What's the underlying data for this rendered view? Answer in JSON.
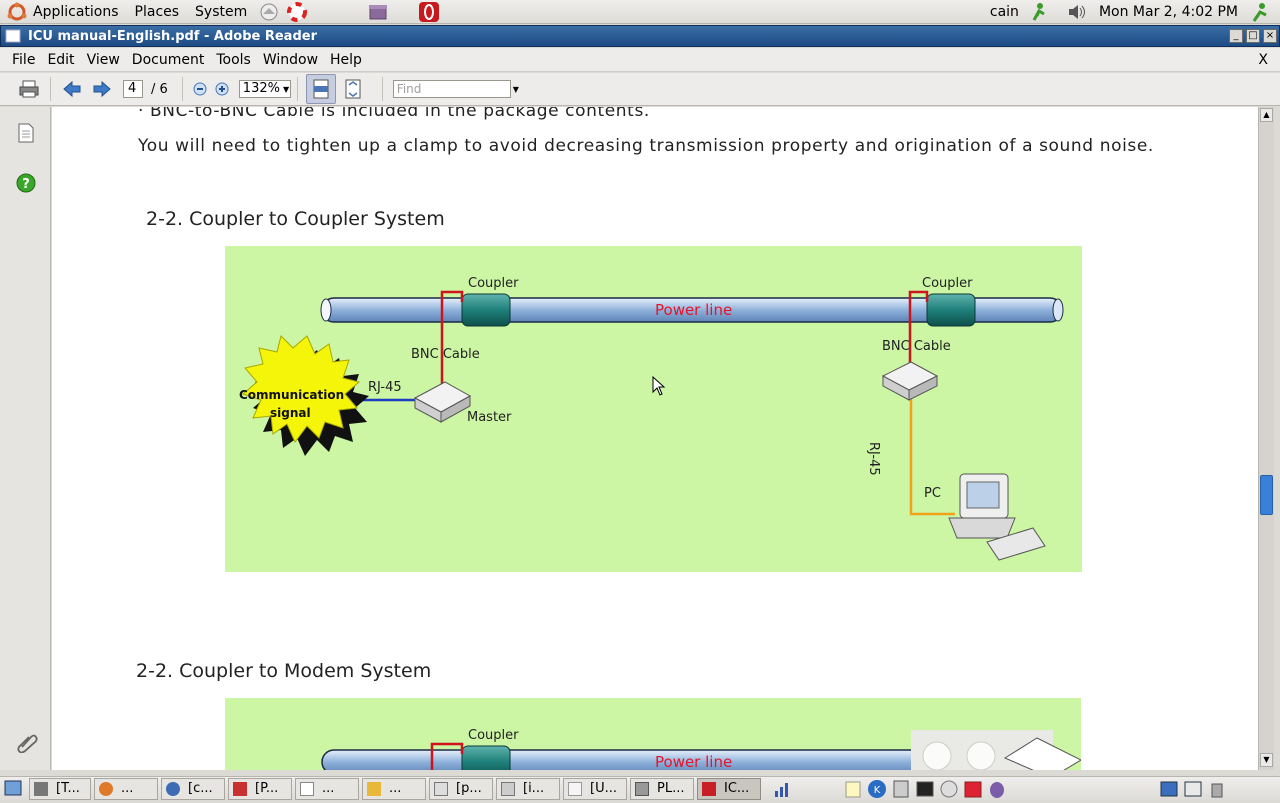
{
  "top_panel": {
    "menus": [
      "Applications",
      "Places",
      "System"
    ],
    "user": "cain",
    "clock": "Mon Mar  2,  4:02 PM"
  },
  "window": {
    "title": "ICU manual-English.pdf - Adobe Reader",
    "controls": [
      "_",
      "□",
      "×"
    ]
  },
  "menubar": {
    "items": [
      "File",
      "Edit",
      "View",
      "Document",
      "Tools",
      "Window",
      "Help"
    ],
    "close": "X"
  },
  "toolbar": {
    "page_current": "4",
    "page_total": "/  6",
    "zoom": "132%",
    "find_placeholder": "Find"
  },
  "document": {
    "line1": "· BNC-to-BNC Cable is included in the package contents.",
    "line2": "You will need to tighten up a clamp to avoid decreasing transmission property and origination of a sound noise.",
    "heading1": "2-2. Coupler to Coupler System",
    "heading2": "2-2. Coupler to Modem System",
    "diagram1": {
      "coupler_left": "Coupler",
      "coupler_right": "Coupler",
      "power_line": "Power line",
      "bnc_left": "BNC Cable",
      "bnc_right": "BNC Cable",
      "rj45_left": "RJ-45",
      "rj45_right": "RJ-45",
      "master": "Master",
      "pc": "PC",
      "signal_line1": "Communication",
      "signal_line2": "signal"
    },
    "diagram2": {
      "coupler": "Coupler",
      "power_line": "Power line"
    }
  },
  "taskbar": {
    "tasks": [
      "[T...",
      "...",
      "[c...",
      "[P...",
      "...",
      "...",
      "[p...",
      "[i...",
      "[U...",
      "PL...",
      "IC..."
    ]
  },
  "colors": {
    "titlebar": "#2a5a95",
    "diagram_bg": "#ccf5a4",
    "power_line_text": "#e8132a",
    "scroll_thumb": "#3b80d8"
  }
}
